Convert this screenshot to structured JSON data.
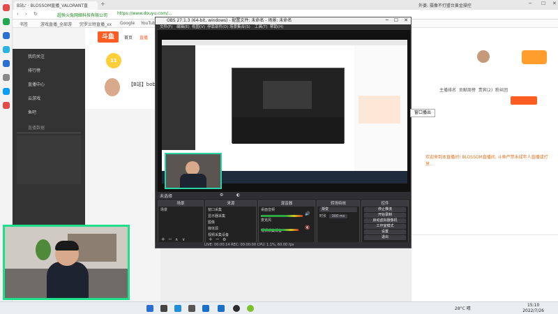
{
  "browser": {
    "tabs": [
      {
        "label": "B站♪ · BLOSSOM直播_VALORANT直"
      },
      {
        "label": "外婆: 摄像不打盟台黄金操控"
      }
    ],
    "url": "https://www.douyu.com/...",
    "site_name": "超快火兔网络科技有限公司",
    "bookmarks": [
      "书签",
      "游戏直播_全部游",
      "完罗兰特直播_xx",
      "Google",
      "YouTube"
    ]
  },
  "douyu": {
    "logo": "斗鱼",
    "nav": [
      "首页",
      "直播"
    ],
    "sidebar": [
      "我的关注",
      "排行榜",
      "直播中心",
      "云游戏",
      "鱼吧"
    ],
    "sidebar_section": "直播数据",
    "room": {
      "name": "【B站】bob",
      "level": "11"
    },
    "chat_tabs": [
      "主播排名",
      "贡献周榜",
      "贵宾(2)",
      "粉丝团"
    ],
    "chat_message": "欢迎来到本直播间! BLOSSOM直播间, 斗鱼严禁未成年人直播或打赏..."
  },
  "obs": {
    "title": "OBS 27.1.3 (64-bit, windows) - 配置文件: 未命名 - 场景: 未命名",
    "menu": [
      "文件(F)",
      "编辑(E)",
      "视图(V)",
      "停靠部件(D)",
      "场景集合(S)",
      "工具(T)",
      "帮助(H)"
    ],
    "scene_bar": "未选择",
    "docks": {
      "scenes": {
        "title": "场景",
        "items": [
          "场景"
        ]
      },
      "sources": {
        "title": "来源",
        "items": [
          "窗口采集",
          "显示器采集",
          "图像",
          "媒体源",
          "视频采集设备"
        ]
      },
      "mixer": {
        "title": "混音器",
        "items": [
          "桌面音频",
          "麦克风",
          "视频采集设备"
        ]
      },
      "transitions": {
        "title": "转场特效",
        "value": "渐变",
        "duration_label": "时长",
        "duration": "300 ms"
      },
      "controls": {
        "title": "控件",
        "buttons": [
          "停止推流",
          "开始录制",
          "启动虚拟摄像机",
          "工作室模式",
          "设置",
          "退出"
        ]
      }
    },
    "status": "LIVE: 00:00:14   REC: 00:00:00   CPU: 1.1%, 60.00 fps"
  },
  "popup": {
    "label": "窗口播出"
  },
  "taskbar": {
    "weather": "28°C 晴",
    "time": "15:10",
    "date": "2022/7/26"
  },
  "colors": {
    "douyu_orange": "#ff5d23",
    "webcam_border": "#1fe08a",
    "obs_bg": "#2a2a2e"
  }
}
